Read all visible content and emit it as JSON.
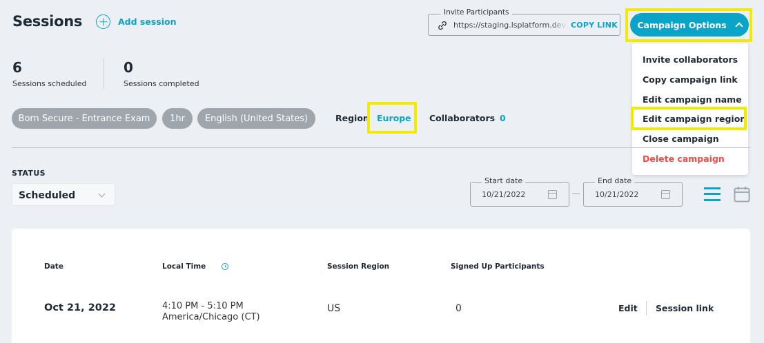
{
  "header": {
    "title": "Sessions",
    "add_session_label": "Add session"
  },
  "invite": {
    "legend": "Invite Participants",
    "url": "https://staging.lsplatform.dev",
    "copy_label": "COPY LINK"
  },
  "campaign_options": {
    "label": "Campaign Options",
    "menu": [
      {
        "label": "Invite collaborators"
      },
      {
        "label": "Copy campaign link"
      },
      {
        "label": "Edit campaign name"
      },
      {
        "label": "Edit campaign region"
      },
      {
        "label": "Close campaign"
      },
      {
        "label": "Delete campaign"
      }
    ]
  },
  "stats": {
    "scheduled": {
      "value": "6",
      "label": "Sessions scheduled"
    },
    "completed": {
      "value": "0",
      "label": "Sessions completed"
    }
  },
  "tags": [
    "Born Secure - Entrance Exam",
    "1hr",
    "English (United States)"
  ],
  "region": {
    "label": "Region",
    "value": "Europe"
  },
  "collaborators": {
    "label": "Collaborators",
    "value": "0"
  },
  "filters": {
    "status_label": "STATUS",
    "status_value": "Scheduled",
    "start_date": {
      "legend": "Start date",
      "value": "10/21/2022"
    },
    "end_date": {
      "legend": "End date",
      "value": "10/21/2022"
    }
  },
  "table": {
    "headers": [
      "Date",
      "Local Time",
      "Session Region",
      "Signed Up Participants"
    ],
    "rows": [
      {
        "date": "Oct 21, 2022",
        "time": "4:10 PM - 5:10 PM",
        "timezone": "America/Chicago (CT)",
        "region": "US",
        "participants": "0",
        "edit_label": "Edit",
        "link_label": "Session link"
      }
    ]
  },
  "colors": {
    "accent": "#0aa4c8",
    "highlight": "#f2ea00",
    "danger": "#ef4a4a",
    "background": "#eceff3",
    "pill": "#9ea5ad"
  }
}
